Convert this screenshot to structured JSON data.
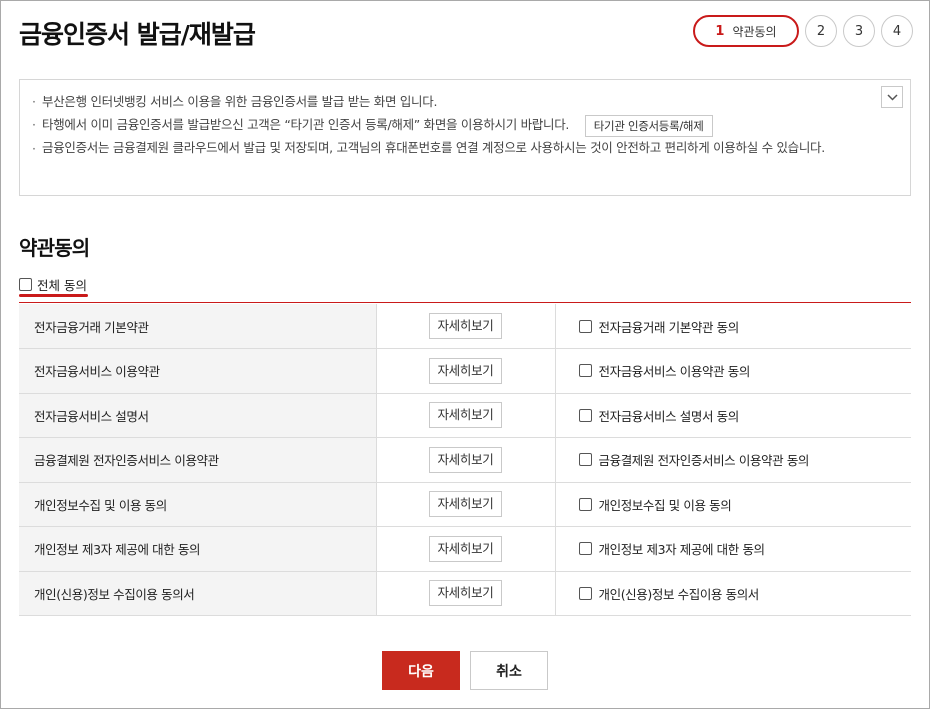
{
  "header": {
    "title": "금융인증서 발급/재발급",
    "steps": [
      {
        "num": "1",
        "label": "약관동의"
      },
      {
        "num": "2"
      },
      {
        "num": "3"
      },
      {
        "num": "4"
      }
    ]
  },
  "notice": {
    "items": [
      "부산은행 인터넷뱅킹 서비스 이용을 위한 금융인증서를 발급 받는 화면 입니다.",
      "타행에서 이미 금융인증서를 발급받으신 고객은 “타기관 인증서 등록/해제” 화면을 이용하시기 바랍니다.",
      "금융인증서는 금융결제원 클라우드에서 발급 및 저장되며, 고객님의 휴대폰번호를 연결 계정으로 사용하시는 것이 안전하고 편리하게 이용하실 수 있습니다."
    ],
    "inline_button": "타기관 인증서등록/해제",
    "collapse_icon": "chevron-down-icon"
  },
  "section": {
    "title": "약관동의",
    "all_agree_label": "전체 동의"
  },
  "terms": [
    {
      "name": "전자금융거래 기본약관",
      "view_label": "자세히보기",
      "agree_label": "전자금융거래 기본약관 동의"
    },
    {
      "name": "전자금융서비스 이용약관",
      "view_label": "자세히보기",
      "agree_label": "전자금융서비스 이용약관 동의"
    },
    {
      "name": "전자금융서비스 설명서",
      "view_label": "자세히보기",
      "agree_label": "전자금융서비스 설명서 동의"
    },
    {
      "name": "금융결제원 전자인증서비스 이용약관",
      "view_label": "자세히보기",
      "agree_label": "금융결제원 전자인증서비스 이용약관 동의"
    },
    {
      "name": "개인정보수집 및 이용 동의",
      "view_label": "자세히보기",
      "agree_label": "개인정보수집 및 이용 동의"
    },
    {
      "name": "개인정보 제3자 제공에 대한 동의",
      "view_label": "자세히보기",
      "agree_label": "개인정보 제3자 제공에 대한 동의"
    },
    {
      "name": "개인(신용)정보 수집이용 동의서",
      "view_label": "자세히보기",
      "agree_label": "개인(신용)정보 수집이용 동의서"
    }
  ],
  "actions": {
    "next_label": "다음",
    "cancel_label": "취소"
  },
  "colors": {
    "accent": "#c91a1a",
    "primary_button": "#c82a1e"
  }
}
